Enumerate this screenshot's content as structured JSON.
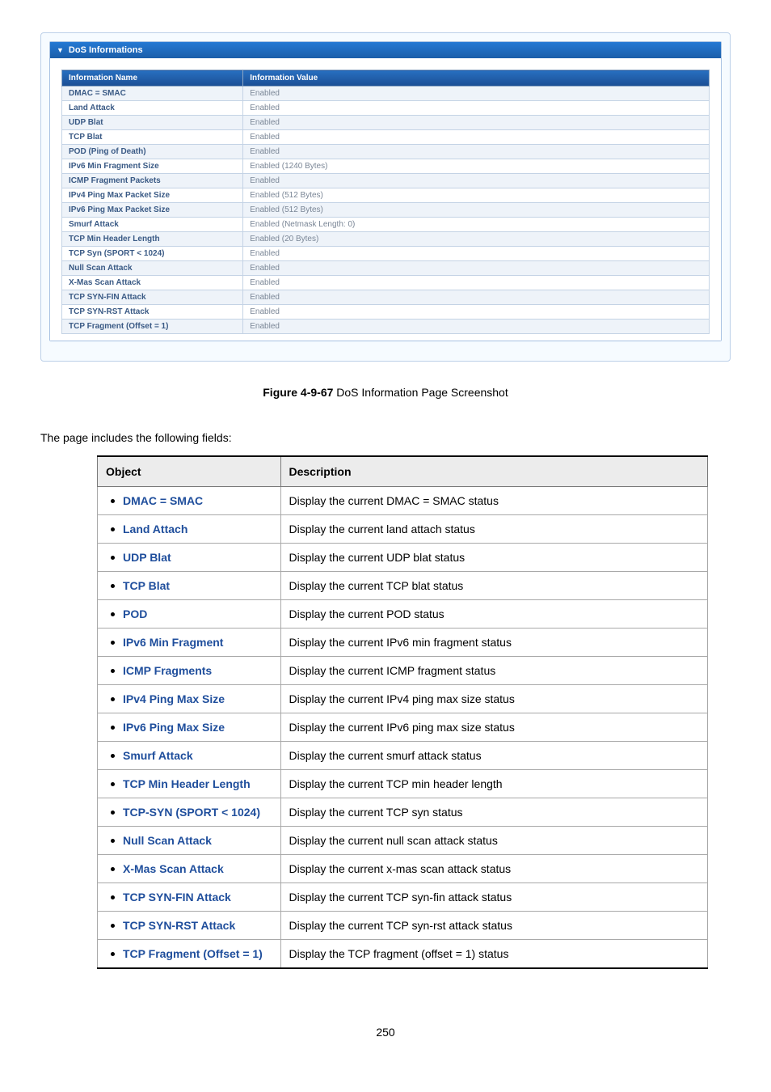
{
  "panel": {
    "title": "DoS Informations",
    "header_name": "Information Name",
    "header_value": "Information Value",
    "rows": [
      {
        "name": "DMAC = SMAC",
        "value": "Enabled"
      },
      {
        "name": "Land Attack",
        "value": "Enabled"
      },
      {
        "name": "UDP Blat",
        "value": "Enabled"
      },
      {
        "name": "TCP Blat",
        "value": "Enabled"
      },
      {
        "name": "POD (Ping of Death)",
        "value": "Enabled"
      },
      {
        "name": "IPv6 Min Fragment Size",
        "value": "Enabled (1240 Bytes)"
      },
      {
        "name": "ICMP Fragment Packets",
        "value": "Enabled"
      },
      {
        "name": "IPv4 Ping Max Packet Size",
        "value": "Enabled (512 Bytes)"
      },
      {
        "name": "IPv6 Ping Max Packet Size",
        "value": "Enabled (512 Bytes)"
      },
      {
        "name": "Smurf Attack",
        "value": "Enabled (Netmask Length: 0)"
      },
      {
        "name": "TCP Min Header Length",
        "value": "Enabled (20 Bytes)"
      },
      {
        "name": "TCP Syn (SPORT < 1024)",
        "value": "Enabled"
      },
      {
        "name": "Null Scan Attack",
        "value": "Enabled"
      },
      {
        "name": "X-Mas Scan Attack",
        "value": "Enabled"
      },
      {
        "name": "TCP SYN-FIN Attack",
        "value": "Enabled"
      },
      {
        "name": "TCP SYN-RST Attack",
        "value": "Enabled"
      },
      {
        "name": "TCP Fragment (Offset = 1)",
        "value": "Enabled"
      }
    ]
  },
  "caption": {
    "prefix": "Figure 4-9-67",
    "text": " DoS Information Page Screenshot"
  },
  "lead": "The page includes the following fields:",
  "desc": {
    "col_object": "Object",
    "col_description": "Description",
    "rows": [
      {
        "object": "DMAC = SMAC",
        "description": "Display the current DMAC = SMAC status"
      },
      {
        "object": "Land Attach",
        "description": "Display the current land attach status"
      },
      {
        "object": "UDP Blat",
        "description": "Display the current UDP blat status"
      },
      {
        "object": "TCP Blat",
        "description": "Display the current TCP blat status"
      },
      {
        "object": "POD",
        "description": "Display the current POD status"
      },
      {
        "object": "IPv6 Min Fragment",
        "description": "Display the current IPv6 min fragment status"
      },
      {
        "object": "ICMP Fragments",
        "description": "Display the current ICMP fragment status"
      },
      {
        "object": "IPv4 Ping Max Size",
        "description": "Display the current IPv4 ping max size status"
      },
      {
        "object": "IPv6 Ping Max Size",
        "description": "Display the current IPv6 ping max size status"
      },
      {
        "object": "Smurf Attack",
        "description": "Display the current smurf attack status"
      },
      {
        "object": "TCP Min Header Length",
        "description": "Display the current TCP min header length"
      },
      {
        "object": "TCP-SYN (SPORT < 1024)",
        "description": "Display the current TCP syn status"
      },
      {
        "object": "Null Scan Attack",
        "description": "Display the current null scan attack status"
      },
      {
        "object": "X-Mas Scan Attack",
        "description": "Display the current x-mas scan attack status"
      },
      {
        "object": "TCP SYN-FIN Attack",
        "description": "Display the current TCP syn-fin attack status"
      },
      {
        "object": "TCP SYN-RST Attack",
        "description": "Display the current TCP syn-rst attack status"
      },
      {
        "object": "TCP Fragment (Offset = 1)",
        "description": "Display the TCP fragment (offset = 1) status"
      }
    ]
  },
  "page_number": "250"
}
